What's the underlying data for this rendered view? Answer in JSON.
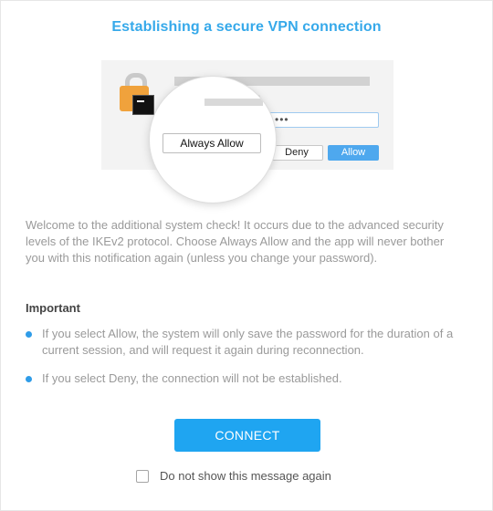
{
  "dialog": {
    "title": "Establishing a secure VPN connection"
  },
  "illustration": {
    "password_dots": "•••",
    "small_field_dots": "••",
    "deny_label": "Deny",
    "allow_label": "Allow",
    "always_allow_label": "Always Allow"
  },
  "description": "Welcome to the additional system check! It occurs due to the advanced security levels of the IKEv2 protocol. Choose Always Allow and the app will never bother you with this notification again (unless you change your password).",
  "important": {
    "heading": "Important",
    "bullets": [
      "If you select Allow, the system will only save the password for the duration of a current session, and will request it again during reconnection.",
      "If you select Deny, the connection will not be established."
    ]
  },
  "actions": {
    "connect_label": "CONNECT",
    "dont_show_label": "Do not show this message again",
    "dont_show_checked": false
  },
  "colors": {
    "accent": "#1fa5f1",
    "title": "#36a9ea",
    "bullet": "#2f9ce8",
    "lock": "#f0a23c"
  }
}
